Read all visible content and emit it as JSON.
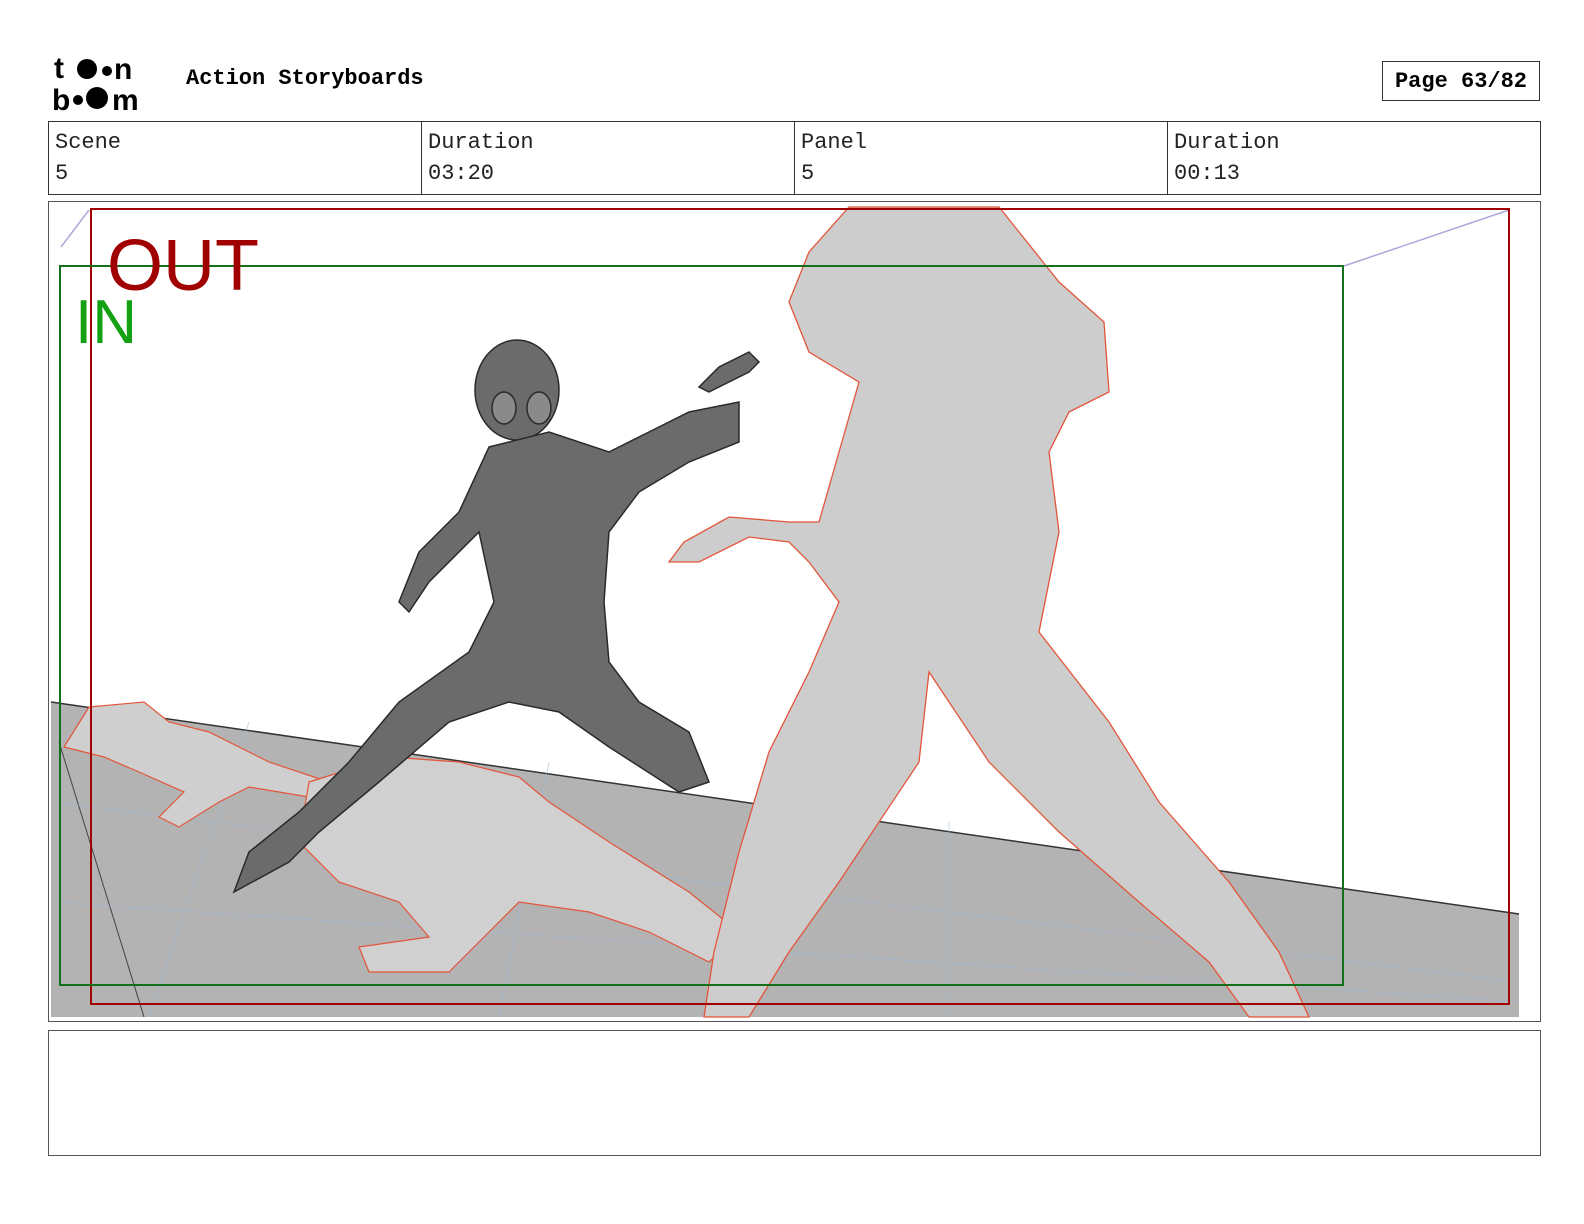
{
  "header": {
    "logo_text": "toon boom",
    "title": "Action Storyboards",
    "page": "Page 63/82"
  },
  "info": {
    "scene_label": "Scene",
    "scene_value": "5",
    "scene_duration_label": "Duration",
    "scene_duration_value": "03:20",
    "panel_label": "Panel",
    "panel_value": "5",
    "panel_duration_label": "Duration",
    "panel_duration_value": "00:13"
  },
  "frame": {
    "out_label": "OUT",
    "in_label": "IN",
    "out_color": "#a00000",
    "in_color": "#13a013"
  },
  "notes": {
    "text": ""
  }
}
